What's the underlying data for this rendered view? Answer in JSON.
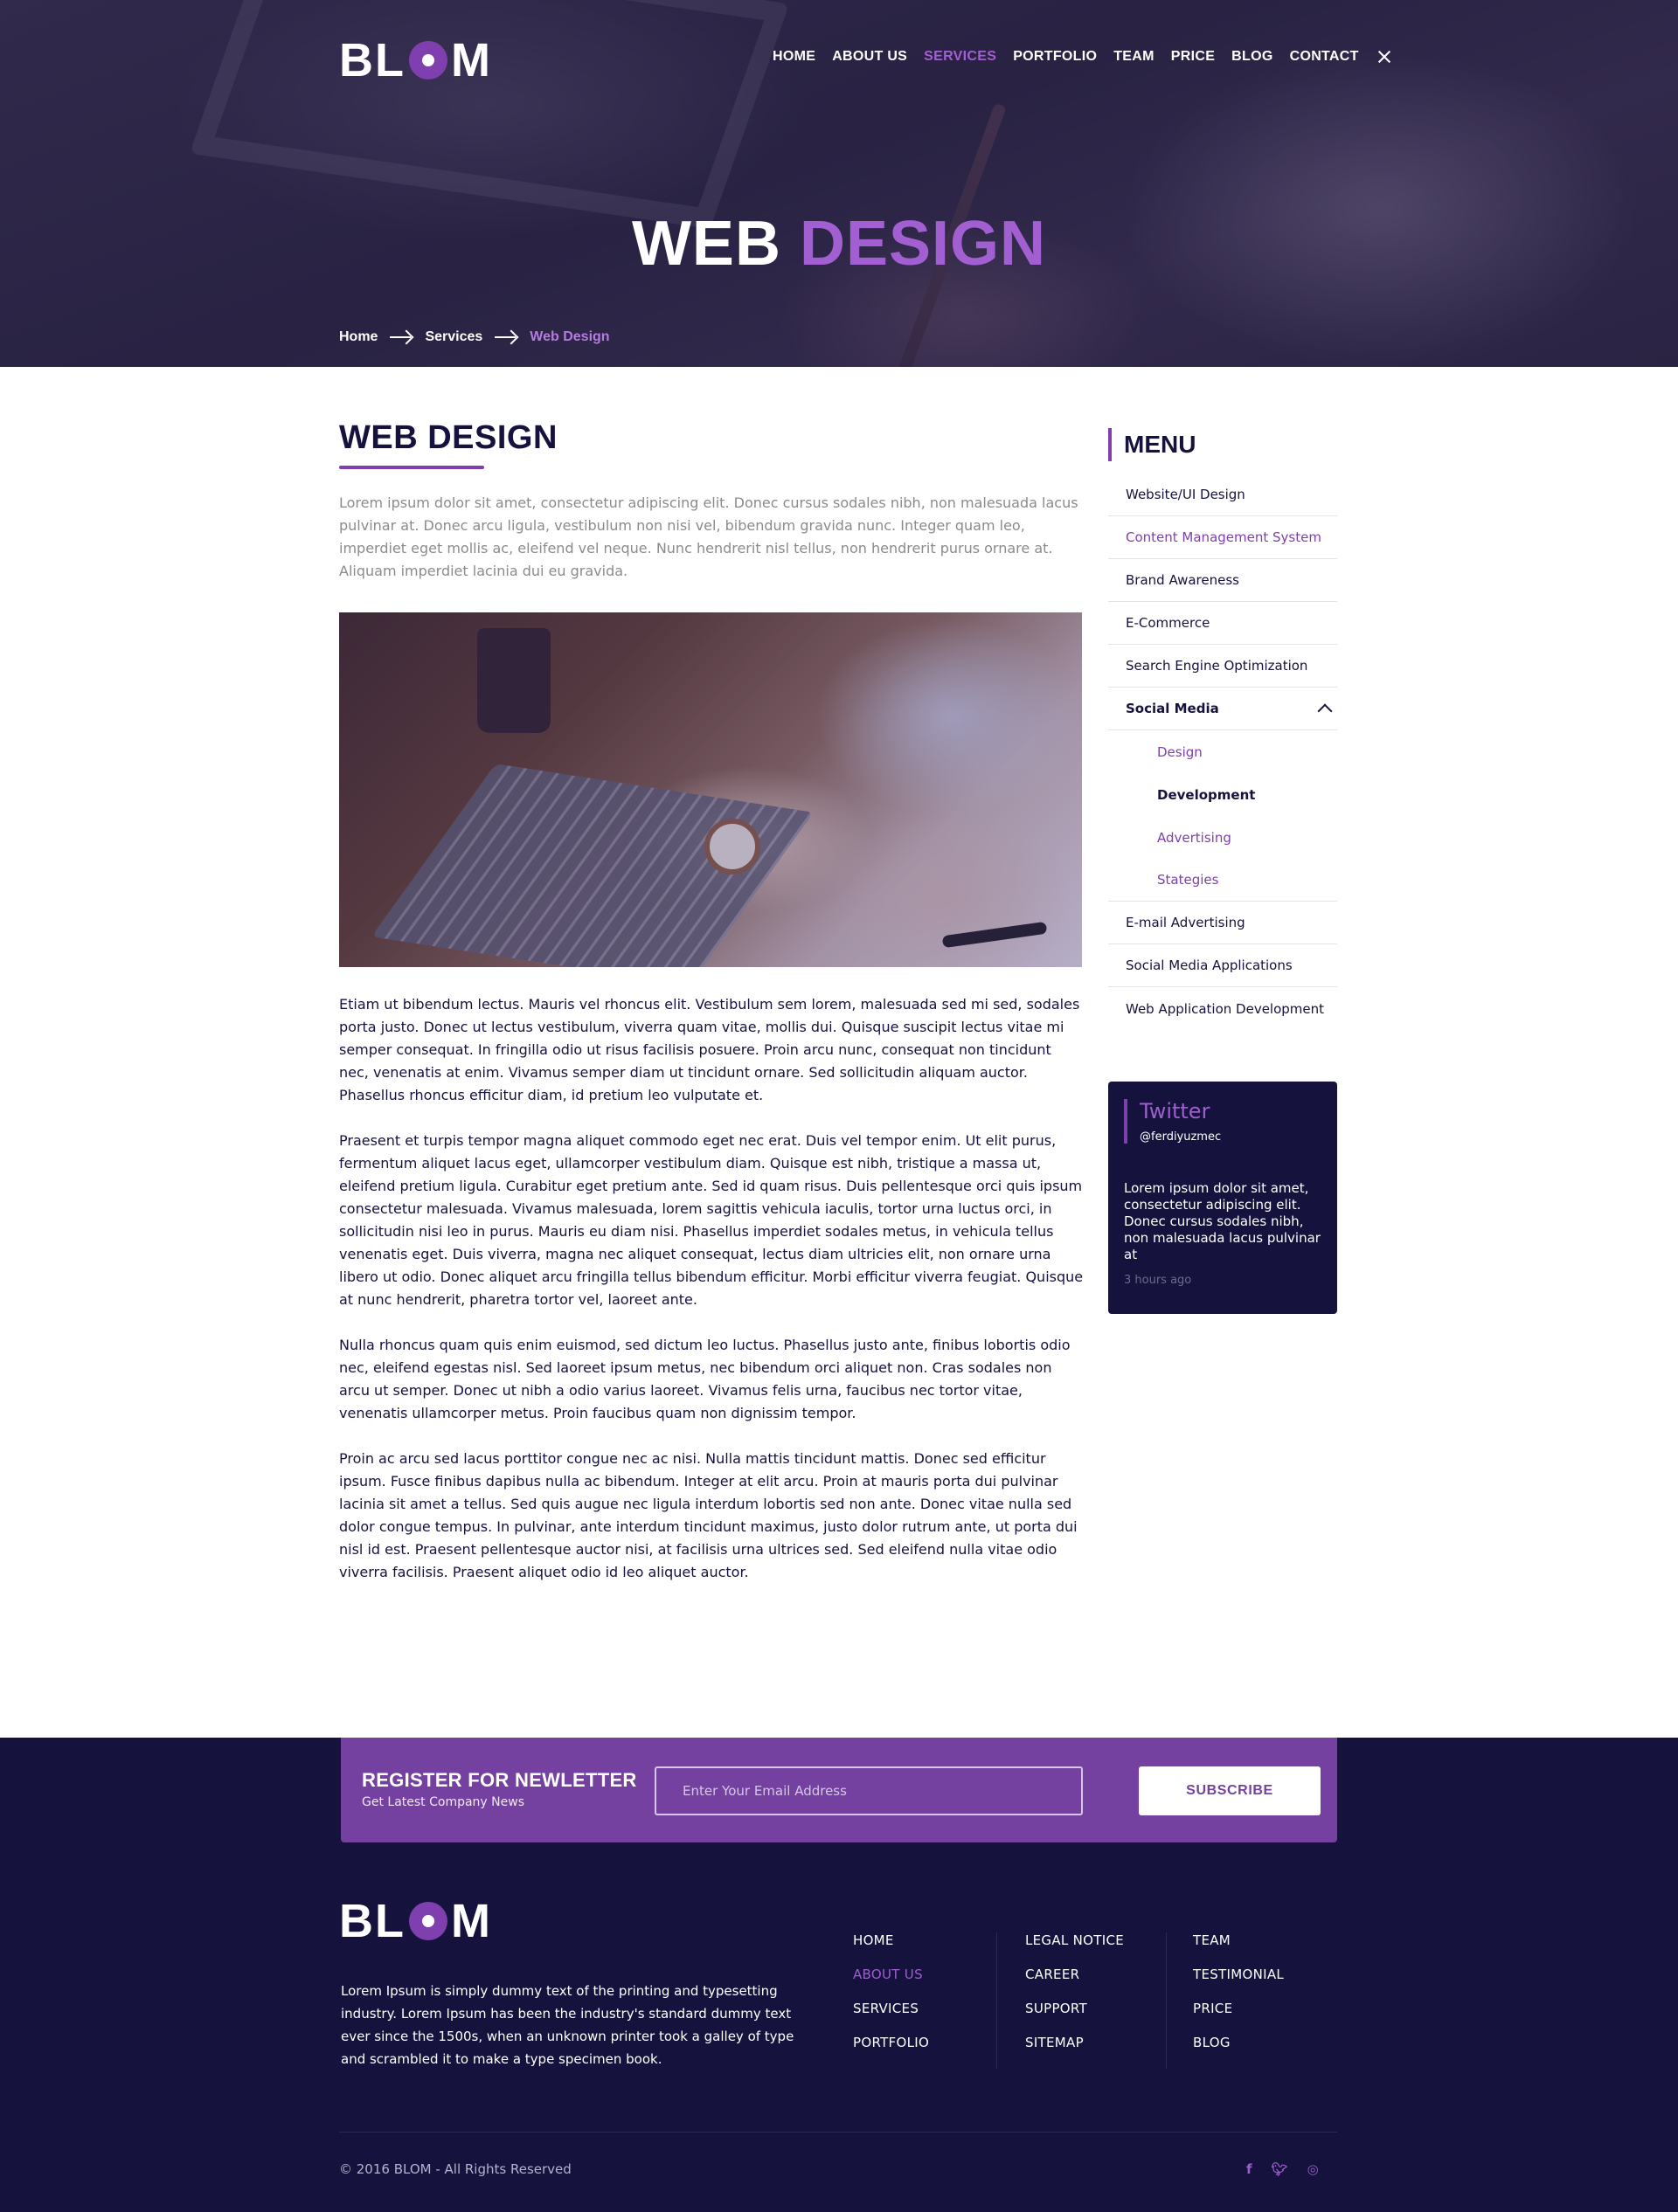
{
  "brand": {
    "logo_left": "BL",
    "logo_right": "M"
  },
  "nav": {
    "items": [
      {
        "label": "HOME"
      },
      {
        "label": "ABOUT US"
      },
      {
        "label": "SERVICES"
      },
      {
        "label": "PORTFOLIO"
      },
      {
        "label": "TEAM"
      },
      {
        "label": "PRICE"
      },
      {
        "label": "BLOG"
      },
      {
        "label": "CONTACT"
      }
    ],
    "active": "SERVICES"
  },
  "hero": {
    "title_white": "WEB",
    "title_purple": "DESIGN"
  },
  "breadcrumb": {
    "home": "Home",
    "services": "Services",
    "current": "Web Design"
  },
  "main": {
    "heading": "WEB DESIGN",
    "intro": "Lorem ipsum dolor sit amet, consectetur adipiscing elit. Donec cursus sodales nibh, non malesuada lacus pulvinar at. Donec arcu ligula, vestibulum non nisi vel, bibendum gravida nunc. Integer quam leo, imperdiet eget mollis ac, eleifend vel neque. Nunc hendrerit nisl tellus, non hendrerit purus ornare at. Aliquam imperdiet lacinia dui eu gravida.",
    "paragraphs": [
      "Etiam ut bibendum lectus. Mauris vel rhoncus elit. Vestibulum sem lorem, malesuada sed mi sed, sodales porta justo. Donec ut lectus vestibulum, viverra quam vitae, mollis dui. Quisque suscipit lectus vitae mi semper consequat. In fringilla odio ut risus facilisis posuere. Proin arcu nunc, consequat non tincidunt nec, venenatis at enim. Vivamus semper diam ut tincidunt ornare. Sed sollicitudin aliquam auctor. Phasellus rhoncus efficitur diam, id pretium leo vulputate et.",
      "Praesent et turpis tempor magna aliquet commodo eget nec erat. Duis vel tempor enim. Ut elit purus, fermentum aliquet lacus eget, ullamcorper vestibulum diam. Quisque est nibh, tristique a massa ut, eleifend pretium ligula. Curabitur eget pretium ante. Sed id quam risus. Duis pellentesque orci quis ipsum consectetur malesuada. Vivamus malesuada, lorem sagittis vehicula iaculis, tortor urna luctus orci, in sollicitudin nisi leo in purus. Mauris eu diam nisi. Phasellus imperdiet sodales metus, in vehicula tellus venenatis eget. Duis viverra, magna nec aliquet consequat, lectus diam ultricies elit, non ornare urna libero ut odio. Donec aliquet arcu fringilla tellus bibendum efficitur. Morbi efficitur viverra feugiat. Quisque at nunc hendrerit, pharetra tortor vel, laoreet ante.",
      "Nulla rhoncus quam quis enim euismod, sed dictum leo luctus. Phasellus justo ante, finibus lobortis odio nec, eleifend egestas nisl. Sed laoreet ipsum metus, nec bibendum orci aliquet non. Cras sodales non arcu ut semper. Donec ut nibh a odio varius laoreet. Vivamus felis urna, faucibus nec tortor vitae, venenatis ullamcorper metus. Proin faucibus quam non dignissim tempor.",
      "Proin ac arcu sed lacus porttitor congue nec ac nisi. Nulla mattis tincidunt mattis. Donec sed efficitur ipsum. Fusce finibus dapibus nulla ac bibendum. Integer at elit arcu. Proin at mauris porta dui pulvinar lacinia sit amet a tellus. Sed quis augue nec ligula interdum lobortis sed non ante. Donec vitae nulla sed dolor congue tempus. In pulvinar, ante interdum tincidunt maximus, justo dolor rutrum ante, ut porta dui nisl id est. Praesent pellentesque auctor nisi, at facilisis urna ultrices sed. Sed eleifend nulla vitae odio viverra facilisis. Praesent aliquet odio id leo aliquet auctor."
    ]
  },
  "sidebar": {
    "heading": "MENU",
    "items": [
      {
        "label": "Website/UI Design"
      },
      {
        "label": "Content Management System"
      },
      {
        "label": "Brand Awareness"
      },
      {
        "label": "E-Commerce"
      },
      {
        "label": "Search Engine Optimization"
      },
      {
        "label": "Social Media"
      },
      {
        "label": "Design"
      },
      {
        "label": "Development"
      },
      {
        "label": "Advertising"
      },
      {
        "label": "Stategies"
      },
      {
        "label": "E-mail Advertising"
      },
      {
        "label": "Social Media Applications"
      },
      {
        "label": "Web Application Development"
      }
    ]
  },
  "twitter": {
    "title": "Twitter",
    "handle": "@ferdiyuzmec",
    "text": "Lorem ipsum dolor sit amet, consectetur adipiscing elit. Donec cursus sodales nibh, non malesuada lacus pulvinar at",
    "time": "3 hours ago"
  },
  "newsletter": {
    "heading": "REGISTER FOR NEWLETTER",
    "subheading": "Get Latest Company News",
    "placeholder": "Enter Your Email Address",
    "button": "SUBSCRIBE"
  },
  "footer": {
    "about": "Lorem Ipsum is simply dummy text of the printing and typesetting industry. Lorem Ipsum has been the industry's standard dummy text ever since the 1500s, when an unknown printer took a galley of type and scrambled it to make a type specimen book.",
    "col1": [
      "HOME",
      "ABOUT US",
      "SERVICES",
      "PORTFOLIO"
    ],
    "col2": [
      "LEGAL NOTICE",
      "CAREER",
      "SUPPORT",
      "SITEMAP"
    ],
    "col3": [
      "TEAM",
      "TESTIMONIAL",
      "PRICE",
      "BLOG"
    ],
    "copyright": "© 2016 BLOM - All Rights Reserved",
    "social": [
      "facebook-icon",
      "twitter-icon",
      "instagram-icon"
    ]
  },
  "colors": {
    "accent": "#7f3fae",
    "navy": "#15123d",
    "newsletter_bg": "#7441a0"
  }
}
